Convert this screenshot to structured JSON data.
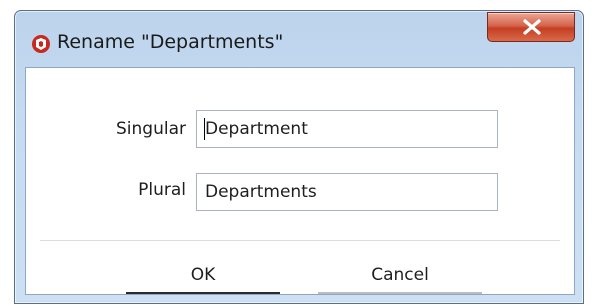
{
  "window": {
    "title": "Rename \"Departments\"",
    "close_icon": "close-x-icon",
    "app_icon": "app-icon"
  },
  "form": {
    "singular": {
      "label": "Singular",
      "value": "Department"
    },
    "plural": {
      "label": "Plural",
      "value": "Departments"
    }
  },
  "buttons": {
    "ok_label": "OK",
    "cancel_label": "Cancel"
  },
  "colors": {
    "titlebar": "#c6dbf1",
    "close_button": "#c43f22",
    "client_background": "#ffffff"
  }
}
